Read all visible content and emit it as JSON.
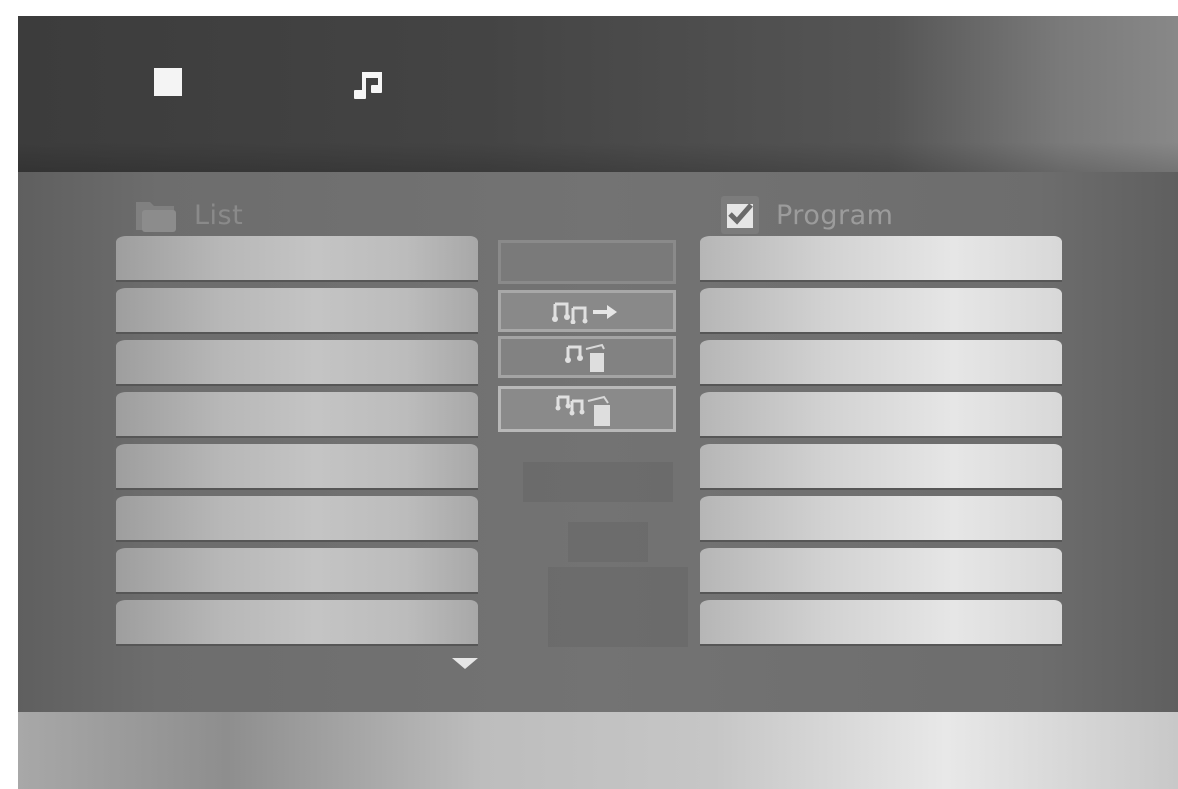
{
  "header": {
    "stop_icon": "stop-icon",
    "music_icon": "music-note-icon"
  },
  "list": {
    "label": "List",
    "icon": "folder-icon",
    "rows": [
      "",
      "",
      "",
      "",
      "",
      "",
      "",
      ""
    ],
    "scroll_icon": "arrow-down-icon"
  },
  "program": {
    "label": "Program",
    "icon": "checkbox-icon",
    "rows": [
      "",
      "",
      "",
      "",
      "",
      "",
      "",
      ""
    ]
  },
  "buttons": [
    {
      "name": "blank-button",
      "icon": ""
    },
    {
      "name": "add-button",
      "icon": "music-add-arrow-icon"
    },
    {
      "name": "delete-button",
      "icon": "music-trash-icon"
    },
    {
      "name": "clear-all-button",
      "icon": "music-multi-trash-icon"
    }
  ]
}
